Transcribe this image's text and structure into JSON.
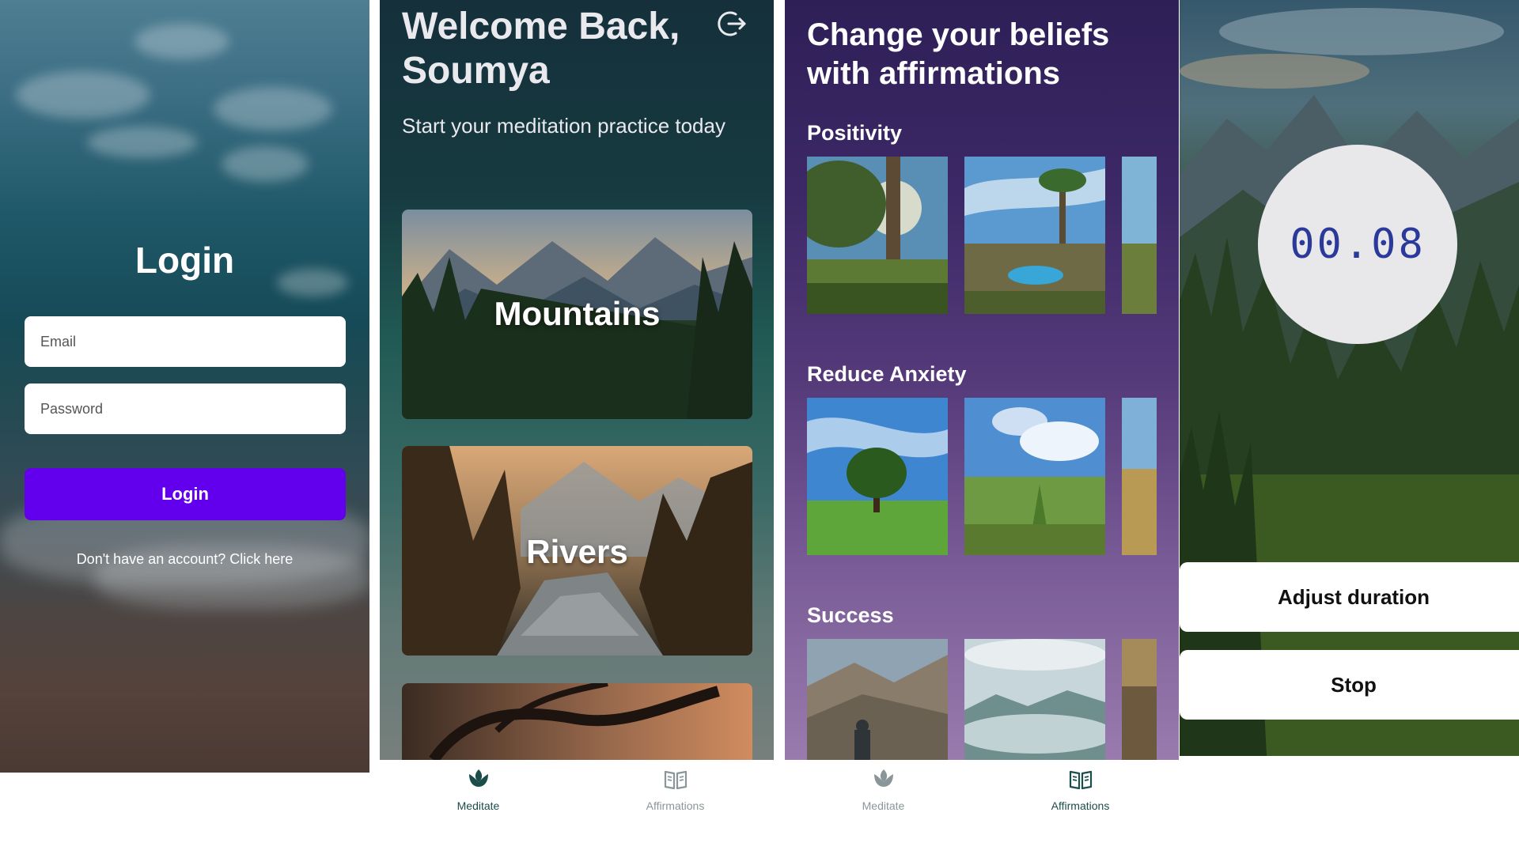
{
  "colors": {
    "primary": "#6200ee",
    "nav_active": "#1b4d4a",
    "nav_inactive": "#8a9699",
    "timer_text": "#2b3a9a"
  },
  "login": {
    "title": "Login",
    "email_placeholder": "Email",
    "password_placeholder": "Password",
    "button_label": "Login",
    "signup_text": "Don't have an account? Click here"
  },
  "meditate": {
    "welcome": "Welcome Back, Soumya",
    "subtitle": "Start your meditation practice today",
    "logout_icon": "logout-icon",
    "cards": [
      {
        "label": "Mountains"
      },
      {
        "label": "Rivers"
      },
      {
        "label": ""
      }
    ]
  },
  "affirmations": {
    "headline": "Change your beliefs with affirmations",
    "sections": [
      {
        "title": "Positivity"
      },
      {
        "title": "Reduce Anxiety"
      },
      {
        "title": "Success"
      }
    ]
  },
  "timer": {
    "value": "00.08",
    "adjust_label": "Adjust duration",
    "stop_label": "Stop"
  },
  "nav_meditate_screen": {
    "active": "Meditate",
    "items": [
      {
        "label": "Meditate",
        "icon": "lotus-icon"
      },
      {
        "label": "Affirmations",
        "icon": "book-icon"
      }
    ]
  },
  "nav_affirmations_screen": {
    "active": "Affirmations",
    "items": [
      {
        "label": "Meditate",
        "icon": "lotus-icon"
      },
      {
        "label": "Affirmations",
        "icon": "book-icon"
      }
    ]
  }
}
